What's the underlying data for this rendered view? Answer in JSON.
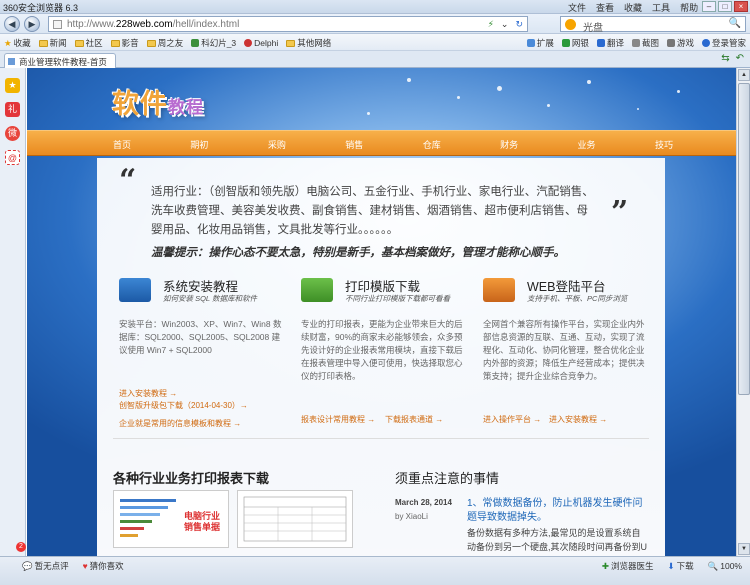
{
  "browser": {
    "title": "360安全浏览器 6.3",
    "menu": [
      "文件",
      "查看",
      "收藏",
      "工具",
      "帮助"
    ],
    "url_prefix": "http://www.",
    "url_domain": "228web.com",
    "url_path": "/hell/index.html",
    "search_value": "光盘",
    "favorites_label": "收藏",
    "favorites": [
      "新闻",
      "社区",
      "影音",
      "周之友",
      "科幻片_3",
      "Delphi",
      "其他网络"
    ],
    "toolbar_right": [
      "扩展",
      "网银",
      "翻译",
      "截图",
      "游戏",
      "登录管家"
    ],
    "tab_label": "商业管理软件教程-首页"
  },
  "site": {
    "logo_main": "软件",
    "logo_small": "教程",
    "nav": [
      "首页",
      "期初",
      "采购",
      "销售",
      "仓库",
      "财务",
      "业务",
      "技巧"
    ],
    "open_quote": "“",
    "close_quote": "”",
    "intro": "适用行业：（创智版和领先版）电脑公司、五金行业、手机行业、家电行业、汽配销售、洗车收费管理、美容美发收费、副食销售、建材销售、烟酒销售、超市便利店销售、母婴用品、化妆用品销售，文具批发等行业。。。。。。",
    "tip": "温馨提示：操作心态不要太急，特别是新手，基本档案做好，管理才能称心顺手。",
    "columns": [
      {
        "title": "系统安装教程",
        "subtitle": "如何安装 SQL 数据库和软件",
        "body": "安装平台：Win2003、XP、Win7、Win8 数据库：SQL2000、SQL2005、SQL2008 建议使用 Win7 + SQL2000",
        "links": [
          "进入安装教程 →",
          "创智版升级包下载（2014-04-30）→",
          "企业就是常用的信息模板和教程 →"
        ]
      },
      {
        "title": "打印模版下载",
        "subtitle": "不同行业打印模版下载都可看看",
        "body": "专业的打印报表，更能为企业带来巨大的后续财富，90%的商家未必能够领会，众多预先设计好的企业报表常用模块，直接下载后在报表管理中导入便可使用，快选择取您心仪的打印表格。",
        "links": [
          "报表设计常用教程 →",
          "下载报表通道 →"
        ]
      },
      {
        "title": "WEB登陆平台",
        "subtitle": "支持手机、平板、PC同步浏览",
        "body": "全网首个兼容所有操作平台，实现企业内外部信息资源的互联、互通、互动，实现了流程化、互动化、协同化管理，整合优化企业内外部的资源；降低生产经营成本；提供决策支持；提升企业综合竞争力。",
        "links": [
          "进入操作平台 →",
          "进入安装教程 →"
        ]
      }
    ],
    "section_reports": "各种行业业务打印报表下载",
    "thumb_caption": "电脑行业销售单据",
    "section_notes": "须重点注意的事情",
    "note_date": "March 28, 2014",
    "note_by": "by XiaoLi",
    "note_headline": "1、常做数据备份，防止机器发生硬件问题导致数据掉失。",
    "note_body": "备份数据有多种方法,最常见的是设置系统自动备份到另一个硬盘,其次随段时间再备份到U盘,更可以利用现在的网络(金山网盘等)设置自动备份的"
  },
  "statusbar": {
    "left": [
      "暂无点评",
      "猜你喜欢"
    ],
    "right": [
      "浏览器医生",
      "下载",
      "100%"
    ],
    "badge": "2"
  },
  "colors": {
    "nav_orange": "#e98a1f",
    "link_orange": "#d06a10",
    "headline_blue": "#1e67b8"
  }
}
